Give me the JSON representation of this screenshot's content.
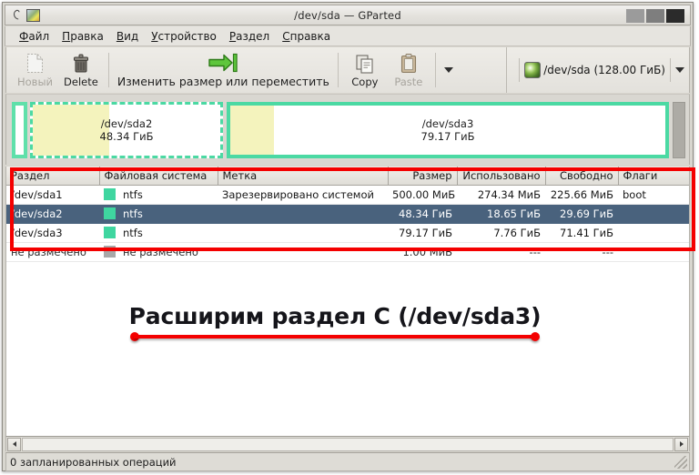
{
  "window": {
    "title": "/dev/sda — GParted",
    "icon": "gparted-app-icon",
    "buttons": [
      {
        "name": "minimize-button",
        "label": ""
      },
      {
        "name": "maximize-button",
        "label": ""
      },
      {
        "name": "close-button",
        "label": ""
      }
    ]
  },
  "menu": {
    "items": [
      {
        "accel": "Ф",
        "rest": "айл"
      },
      {
        "accel": "П",
        "rest": "равка"
      },
      {
        "accel": "В",
        "rest": "ид"
      },
      {
        "accel": "У",
        "rest": "стройство"
      },
      {
        "accel": "Р",
        "rest": "аздел"
      },
      {
        "accel": "С",
        "rest": "правка"
      }
    ]
  },
  "toolbar": {
    "new_label": "Новый",
    "delete_label": "Delete",
    "resize_label": "Изменить размер или переместить",
    "copy_label": "Copy",
    "paste_label": "Paste",
    "overflow_label": "",
    "device_label": "/dev/sda  (128.00 ГиБ)"
  },
  "graphic": {
    "partitions": [
      {
        "name": "/dev/sda1",
        "size": "",
        "used_pct": 55,
        "show_text": false
      },
      {
        "name": "/dev/sda2",
        "size": "48.34 ГиБ",
        "used_pct": 41,
        "show_text": true
      },
      {
        "name": "/dev/sda3",
        "size": "79.17 ГиБ",
        "used_pct": 10,
        "show_text": true
      }
    ]
  },
  "table": {
    "columns": [
      "Раздел",
      "Файловая система",
      "Метка",
      "Размер",
      "Использовано",
      "Свободно",
      "Флаги"
    ],
    "rows": [
      {
        "device": "/dev/sda1",
        "fs": "ntfs",
        "fs_color": "#3fd6a0",
        "label": "Зарезервировано системой",
        "size": "500.00 МиБ",
        "used": "274.34 МиБ",
        "free": "225.66 МиБ",
        "flags": "boot",
        "selected": false
      },
      {
        "device": "/dev/sda2",
        "fs": "ntfs",
        "fs_color": "#3fd6a0",
        "label": "",
        "size": "48.34 ГиБ",
        "used": "18.65 ГиБ",
        "free": "29.69 ГиБ",
        "flags": "",
        "selected": true
      },
      {
        "device": "/dev/sda3",
        "fs": "ntfs",
        "fs_color": "#3fd6a0",
        "label": "",
        "size": "79.17 ГиБ",
        "used": "7.76 ГиБ",
        "free": "71.41 ГиБ",
        "flags": "",
        "selected": false
      },
      {
        "device": "не размечено",
        "fs": "не размечено",
        "fs_color": "#a8a8a8",
        "label": "",
        "size": "1.00 МиБ",
        "used": "---",
        "free": "---",
        "flags": "",
        "selected": false
      }
    ]
  },
  "annotation": {
    "text": "Расширим раздел C (/dev/sda3)",
    "color": "#f40000"
  },
  "status": {
    "text": "0 запланированных операций"
  },
  "colors": {
    "selection": "#49627d",
    "partition_border": "#4bd9a3",
    "partition_used": "#f4f3bd",
    "annotation_red": "#f40000"
  }
}
